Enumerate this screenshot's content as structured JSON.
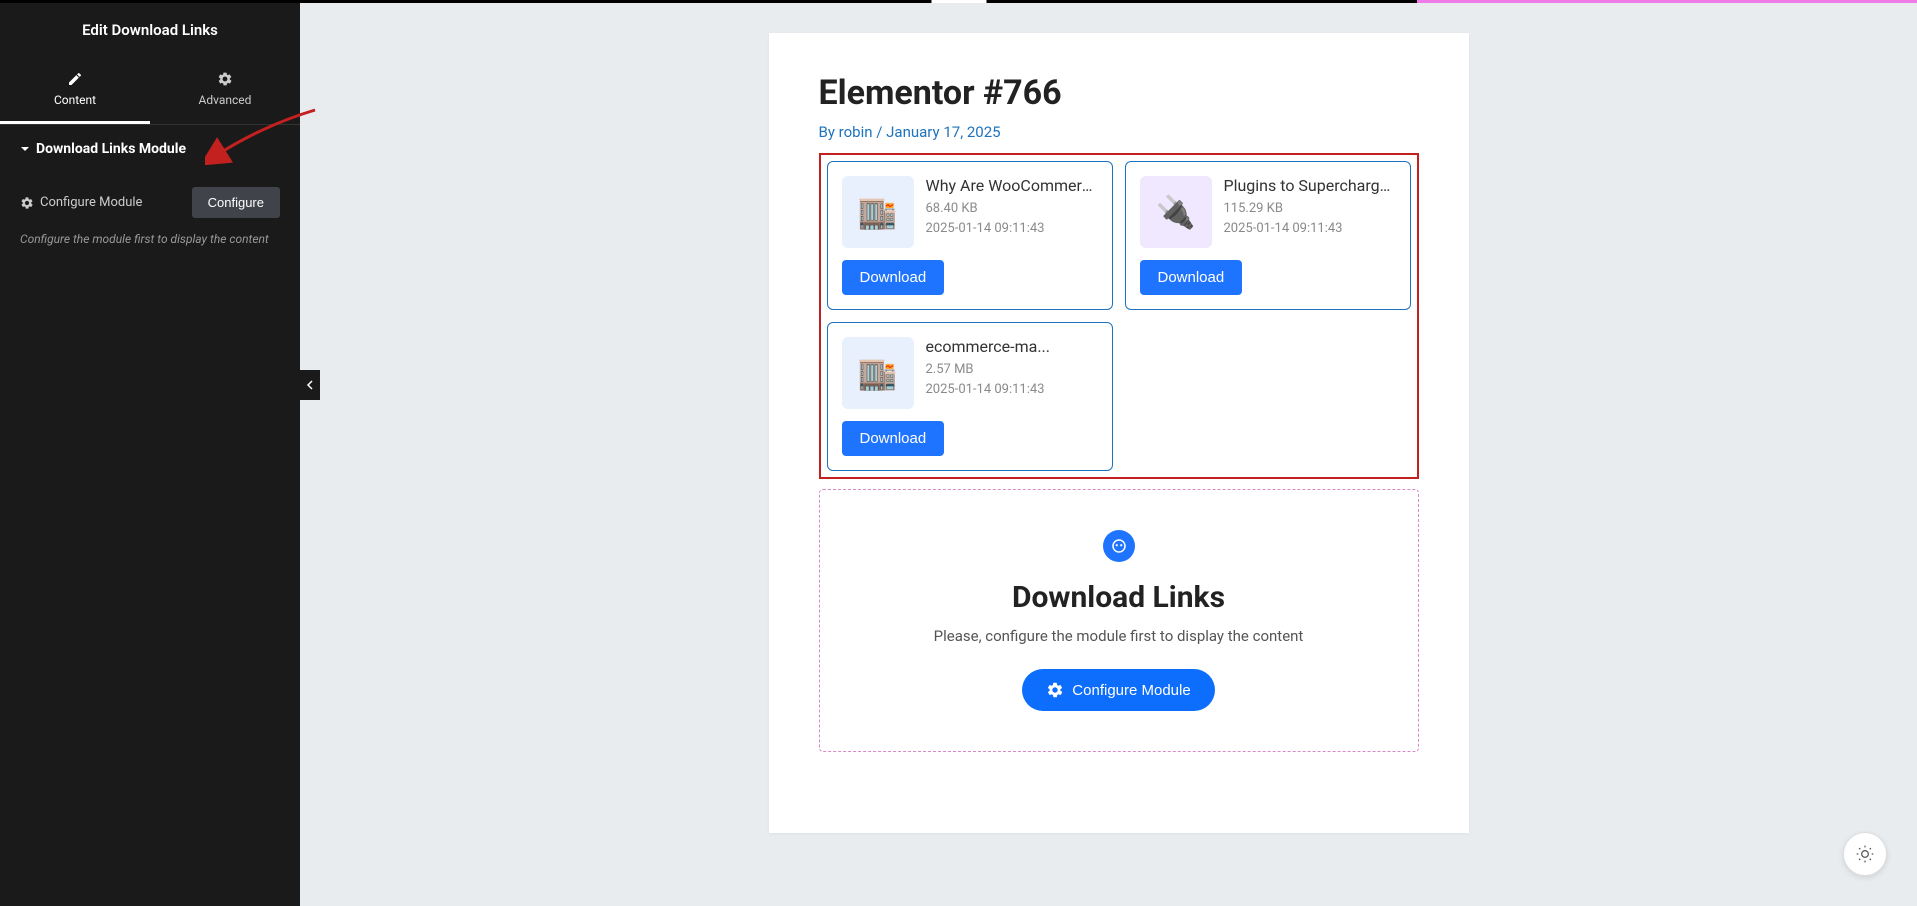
{
  "sidebar": {
    "title": "Edit Download Links",
    "tabs": [
      {
        "label": "Content",
        "icon": "pencil-icon"
      },
      {
        "label": "Advanced",
        "icon": "gear-icon"
      }
    ],
    "section_title": "Download Links Module",
    "configure_label": "Configure Module",
    "configure_button": "Configure",
    "hint": "Configure the module first to display the content"
  },
  "page": {
    "title": "Elementor #766",
    "meta_by": "By robin",
    "meta_sep": " / ",
    "meta_date": "January 17, 2025"
  },
  "downloads": [
    {
      "title": "Why Are WooCommerce Pl",
      "size": "68.40 KB",
      "date": "2025-01-14 09:11:43",
      "button": "Download",
      "thumbColor": "#ffb3a0"
    },
    {
      "title": "Plugins to Supercharge You",
      "size": "115.29 KB",
      "date": "2025-01-14 09:11:43",
      "button": "Download",
      "thumbColor": "#b98aff"
    },
    {
      "title": "ecommerce-ma...",
      "size": "2.57 MB",
      "date": "2025-01-14 09:11:43",
      "button": "Download",
      "thumbColor": "#ffb3a0"
    }
  ],
  "module_placeholder": {
    "title": "Download Links",
    "text": "Please, configure the module first to display the content",
    "button": "Configure Module"
  }
}
